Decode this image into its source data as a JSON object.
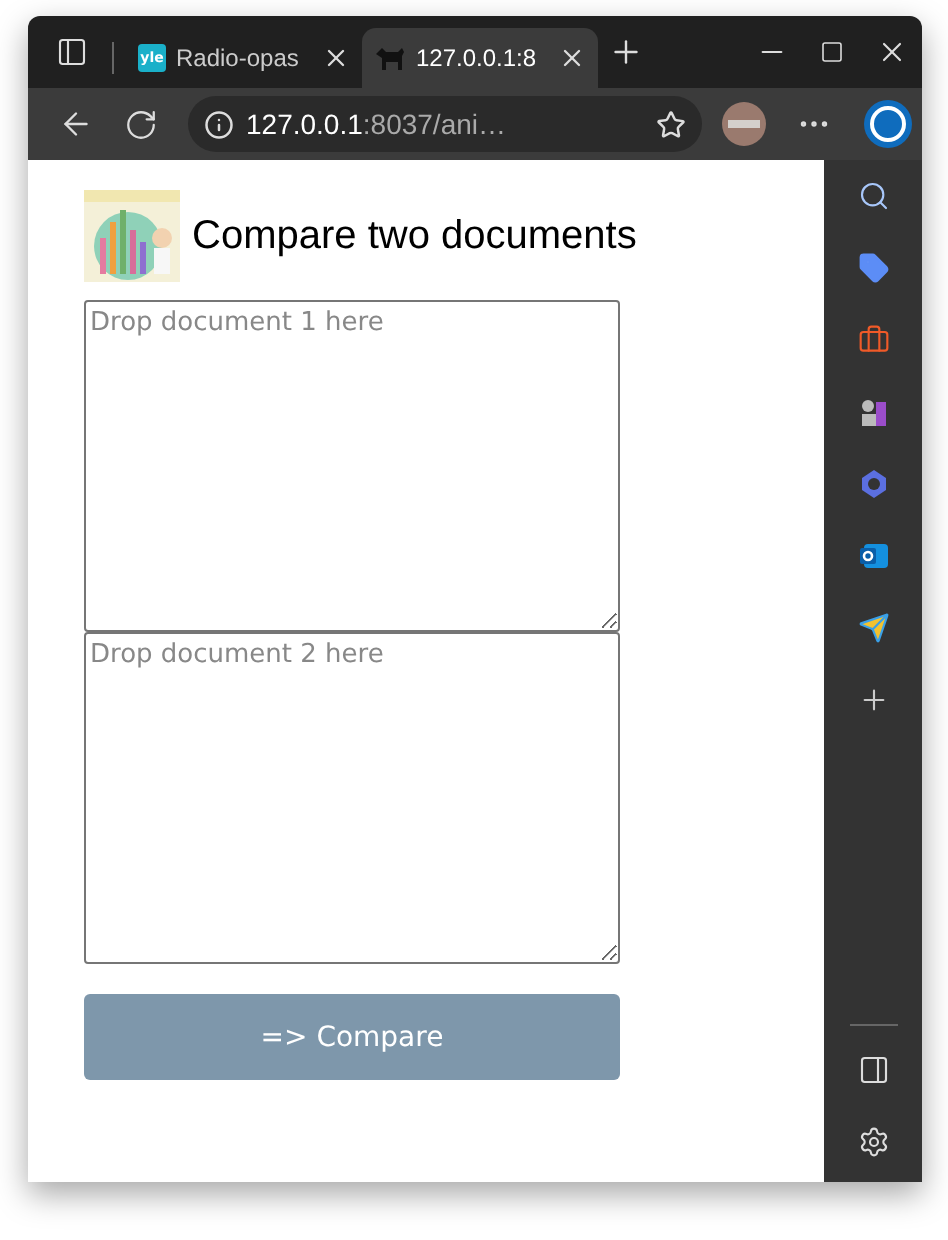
{
  "browser": {
    "tabs": [
      {
        "title": "Radio-opas",
        "favicon_text": "yle",
        "selected": false
      },
      {
        "title": "127.0.0.1:8",
        "selected": true
      }
    ],
    "address": {
      "host": "127.0.0.1",
      "rest": ":8037/ani…"
    }
  },
  "page": {
    "title": "Compare two documents",
    "fields": [
      {
        "placeholder": "Drop document 1 here"
      },
      {
        "placeholder": "Drop document 2 here"
      }
    ],
    "button": "=> Compare"
  }
}
